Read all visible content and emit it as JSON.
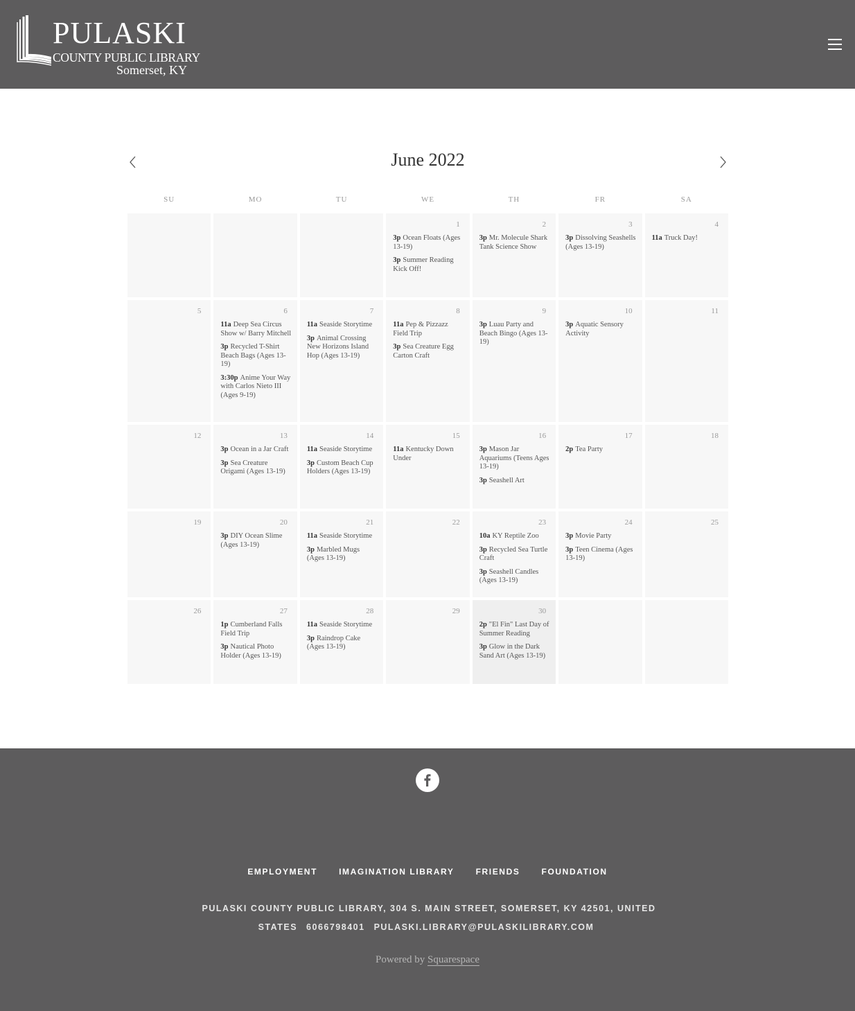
{
  "header": {
    "logo_title": "PULASKI",
    "logo_subtitle": "COUNTY PUBLIC LIBRARY",
    "logo_city": "Somerset, KY"
  },
  "calendar": {
    "month_label": "June 2022",
    "weekdays": [
      "SU",
      "MO",
      "TU",
      "WE",
      "TH",
      "FR",
      "SA"
    ],
    "days": [
      {
        "day": "",
        "events": []
      },
      {
        "day": "",
        "events": []
      },
      {
        "day": "",
        "events": []
      },
      {
        "day": "1",
        "events": [
          {
            "time": "3p",
            "title": "Ocean Floats (Ages 13-19)"
          },
          {
            "time": "3p",
            "title": "Summer Reading Kick Off!"
          }
        ]
      },
      {
        "day": "2",
        "events": [
          {
            "time": "3p",
            "title": "Mr. Molecule Shark Tank Science Show"
          }
        ]
      },
      {
        "day": "3",
        "events": [
          {
            "time": "3p",
            "title": "Dissolving Seashells (Ages 13-19)"
          }
        ]
      },
      {
        "day": "4",
        "events": [
          {
            "time": "11a",
            "title": "Truck Day!"
          }
        ]
      },
      {
        "day": "5",
        "events": []
      },
      {
        "day": "6",
        "events": [
          {
            "time": "11a",
            "title": "Deep Sea Circus Show w/ Barry Mitchell"
          },
          {
            "time": "3p",
            "title": "Recycled T-Shirt Beach Bags (Ages 13-19)"
          },
          {
            "time": "3:30p",
            "title": "Anime Your Way with Carlos Nieto III (Ages 9-19)"
          }
        ]
      },
      {
        "day": "7",
        "events": [
          {
            "time": "11a",
            "title": "Seaside Storytime"
          },
          {
            "time": "3p",
            "title": "Animal Crossing New Horizons Island Hop (Ages 13-19)"
          }
        ]
      },
      {
        "day": "8",
        "events": [
          {
            "time": "11a",
            "title": "Pep & Pizzazz Field Trip"
          },
          {
            "time": "3p",
            "title": "Sea Creature Egg Carton Craft"
          }
        ]
      },
      {
        "day": "9",
        "events": [
          {
            "time": "3p",
            "title": "Luau Party and Beach Bingo (Ages 13-19)"
          }
        ]
      },
      {
        "day": "10",
        "events": [
          {
            "time": "3p",
            "title": "Aquatic Sensory Activity"
          }
        ]
      },
      {
        "day": "11",
        "events": []
      },
      {
        "day": "12",
        "events": []
      },
      {
        "day": "13",
        "events": [
          {
            "time": "3p",
            "title": "Ocean in a Jar Craft"
          },
          {
            "time": "3p",
            "title": "Sea Creature Origami (Ages 13-19)"
          }
        ]
      },
      {
        "day": "14",
        "events": [
          {
            "time": "11a",
            "title": "Seaside Storytime"
          },
          {
            "time": "3p",
            "title": "Custom Beach Cup Holders (Ages 13-19)"
          }
        ]
      },
      {
        "day": "15",
        "events": [
          {
            "time": "11a",
            "title": "Kentucky Down Under"
          }
        ]
      },
      {
        "day": "16",
        "events": [
          {
            "time": "3p",
            "title": "Mason Jar Aquariums (Teens Ages 13-19)"
          },
          {
            "time": "3p",
            "title": "Seashell Art"
          }
        ]
      },
      {
        "day": "17",
        "events": [
          {
            "time": "2p",
            "title": "Tea Party"
          }
        ]
      },
      {
        "day": "18",
        "events": []
      },
      {
        "day": "19",
        "events": []
      },
      {
        "day": "20",
        "events": [
          {
            "time": "3p",
            "title": "DIY Ocean Slime (Ages 13-19)"
          }
        ]
      },
      {
        "day": "21",
        "events": [
          {
            "time": "11a",
            "title": "Seaside Storytime"
          },
          {
            "time": "3p",
            "title": "Marbled Mugs (Ages 13-19)"
          }
        ]
      },
      {
        "day": "22",
        "events": []
      },
      {
        "day": "23",
        "events": [
          {
            "time": "10a",
            "title": "KY Reptile Zoo"
          },
          {
            "time": "3p",
            "title": "Recycled Sea Turtle Craft"
          },
          {
            "time": "3p",
            "title": "Seashell Candles (Ages 13-19)"
          }
        ]
      },
      {
        "day": "24",
        "events": [
          {
            "time": "3p",
            "title": "Movie Party"
          },
          {
            "time": "3p",
            "title": "Teen Cinema (Ages 13-19)"
          }
        ]
      },
      {
        "day": "25",
        "events": []
      },
      {
        "day": "26",
        "events": []
      },
      {
        "day": "27",
        "events": [
          {
            "time": "1p",
            "title": "Cumberland Falls Field Trip"
          },
          {
            "time": "3p",
            "title": "Nautical Photo Holder (Ages 13-19)"
          }
        ]
      },
      {
        "day": "28",
        "events": [
          {
            "time": "11a",
            "title": "Seaside Storytime"
          },
          {
            "time": "3p",
            "title": "Raindrop Cake (Ages 13-19)"
          }
        ]
      },
      {
        "day": "29",
        "events": []
      },
      {
        "day": "30",
        "today": true,
        "events": [
          {
            "time": "2p",
            "title": "\"El Fin\" Last Day of Summer Reading"
          },
          {
            "time": "3p",
            "title": "Glow in the Dark Sand Art (Ages 13-19)"
          }
        ]
      },
      {
        "day": "",
        "events": []
      },
      {
        "day": "",
        "events": []
      }
    ]
  },
  "footer": {
    "nav": [
      "EMPLOYMENT",
      "IMAGINATION LIBRARY",
      "FRIENDS",
      "FOUNDATION"
    ],
    "address": "PULASKI COUNTY PUBLIC LIBRARY, 304 S. MAIN STREET, SOMERSET, KY 42501, UNITED STATES",
    "phone": "6066798401",
    "email": "PULASKI.LIBRARY@PULASKILIBRARY.COM",
    "powered_prefix": "Powered by",
    "powered_link": "Squarespace",
    "social_icon": "facebook-icon"
  },
  "colors": {
    "header_bg": "#5d5c5d",
    "cell_bg": "#f7f7f7",
    "today_bg": "#efefef"
  }
}
